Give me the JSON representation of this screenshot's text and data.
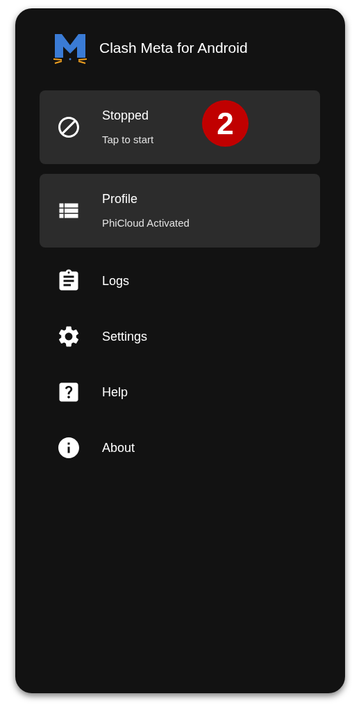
{
  "app": {
    "title": "Clash Meta for Android"
  },
  "cards": [
    {
      "title": "Stopped",
      "subtitle": "Tap to start"
    },
    {
      "title": "Profile",
      "subtitle": "PhiCloud Activated"
    }
  ],
  "menu": [
    {
      "label": "Logs"
    },
    {
      "label": "Settings"
    },
    {
      "label": "Help"
    },
    {
      "label": "About"
    }
  ],
  "step_badge": "2"
}
